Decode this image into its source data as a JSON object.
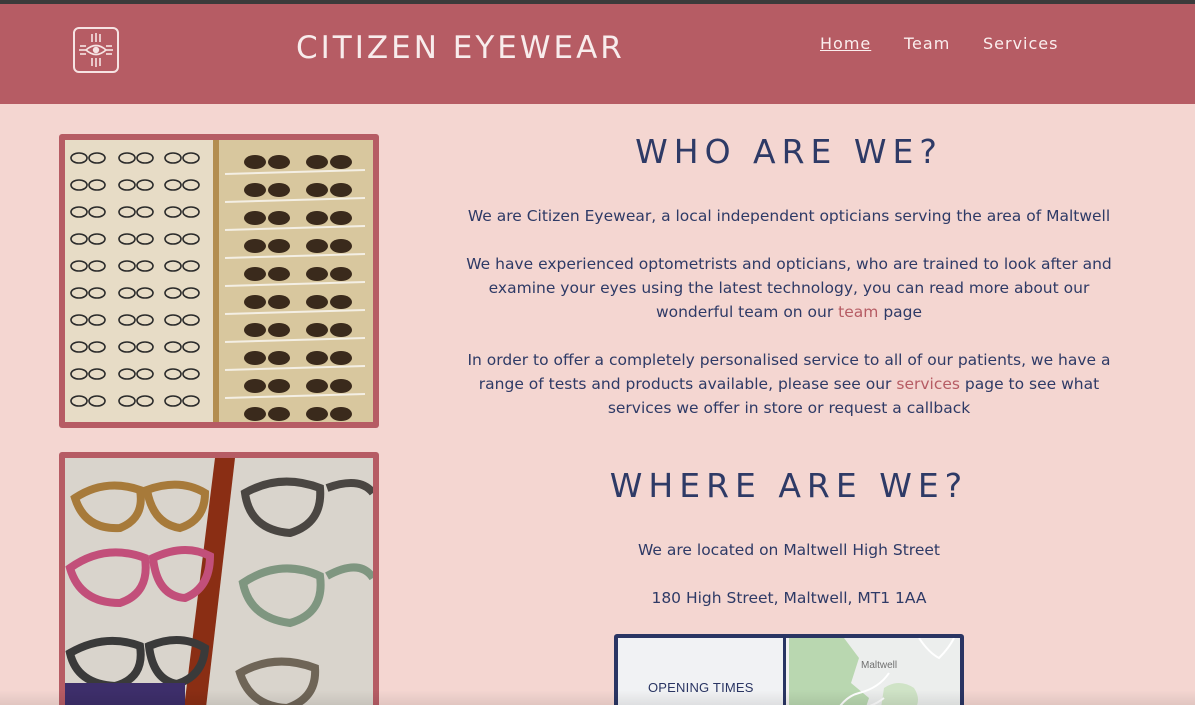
{
  "header": {
    "brand": "CITIZEN EYEWEAR",
    "logo_icon": "eye-logo-icon",
    "nav": [
      {
        "label": "Home",
        "active": true
      },
      {
        "label": "Team",
        "active": false
      },
      {
        "label": "Services",
        "active": false
      }
    ]
  },
  "about": {
    "heading": "WHO ARE WE?",
    "p1": "We are Citizen Eyewear, a local independent opticians serving the area of Maltwell",
    "p2_before": "We have experienced optometrists and opticians, who are trained to look after and examine your eyes using the latest technology, you can read more about our wonderful team on our",
    "p2_link": "team",
    "p2_after": "page",
    "p3_before": "In order to offer a completely personalised service to all of our patients, we have a range of tests and products available, please see our",
    "p3_link": "services",
    "p3_after": "page to see what services we offer in store or request a callback"
  },
  "location": {
    "heading": "WHERE ARE WE?",
    "line1": "We are located on Maltwell High Street",
    "address": "180 High Street, Maltwell, MT1 1AA",
    "hours_title": "OPENING TIMES",
    "map_label": "Maltwell"
  },
  "images": {
    "photo1_alt": "glasses display wall",
    "photo2_alt": "colourful frames close-up"
  },
  "colors": {
    "header": "#b65c64",
    "background": "#f4d6d1",
    "text": "#2e3a66",
    "link": "#b65c64"
  }
}
